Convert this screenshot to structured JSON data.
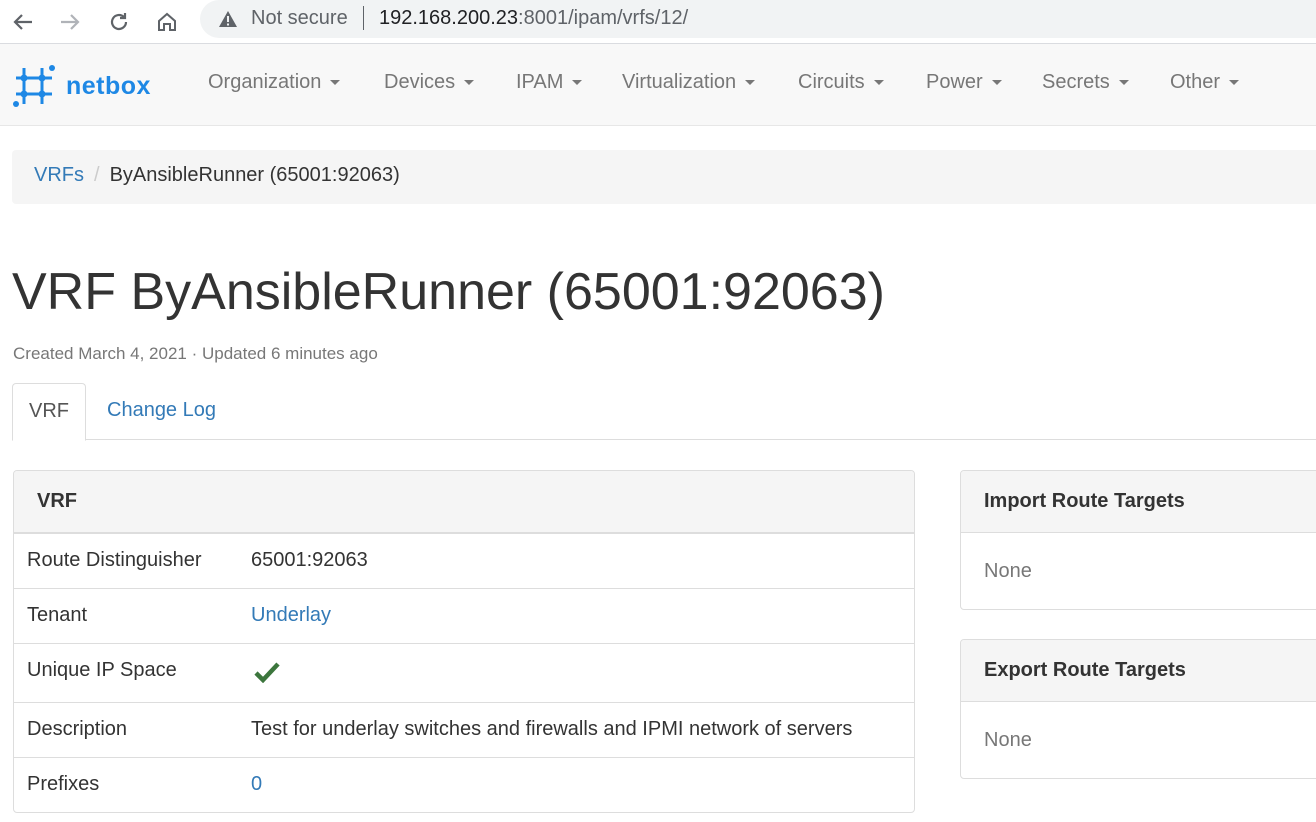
{
  "browser": {
    "security_label": "Not secure",
    "url_host": "192.168.200.23",
    "url_path": ":8001/ipam/vrfs/12/"
  },
  "navbar": {
    "brand": "netbox",
    "items": [
      {
        "label": "Organization"
      },
      {
        "label": "Devices"
      },
      {
        "label": "IPAM"
      },
      {
        "label": "Virtualization"
      },
      {
        "label": "Circuits"
      },
      {
        "label": "Power"
      },
      {
        "label": "Secrets"
      },
      {
        "label": "Other"
      }
    ]
  },
  "breadcrumb": {
    "parent": "VRFs",
    "current": "ByAnsibleRunner (65001:92063)"
  },
  "page": {
    "title": "VRF ByAnsibleRunner (65001:92063)",
    "meta": "Created March 4, 2021 · Updated 6 minutes ago"
  },
  "tabs": [
    {
      "label": "VRF"
    },
    {
      "label": "Change Log"
    }
  ],
  "vrf_panel": {
    "heading": "VRF",
    "rows": [
      {
        "label": "Route Distinguisher",
        "value": "65001:92063"
      },
      {
        "label": "Tenant",
        "value": "Underlay"
      },
      {
        "label": "Unique IP Space",
        "value": "✔"
      },
      {
        "label": "Description",
        "value": "Test for underlay switches and firewalls and IPMI network of servers"
      },
      {
        "label": "Prefixes",
        "value": "0"
      }
    ]
  },
  "import_panel": {
    "heading": "Import Route Targets",
    "body": "None"
  },
  "export_panel": {
    "heading": "Export Route Targets",
    "body": "None"
  },
  "colors": {
    "link": "#337ab7",
    "brand": "#1e88e5",
    "check": "#3c763d"
  }
}
